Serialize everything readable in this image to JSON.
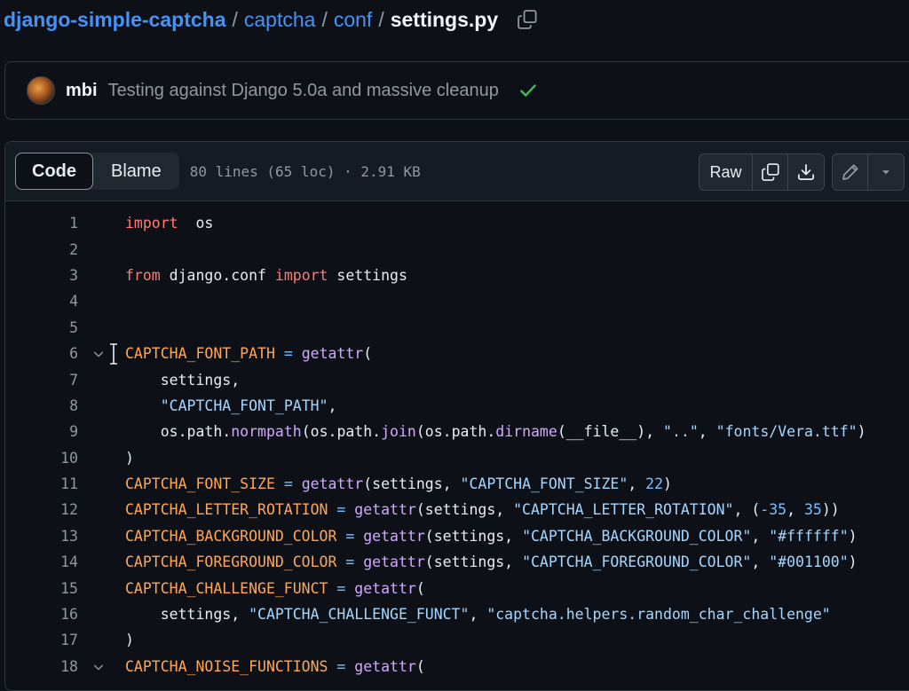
{
  "breadcrumb": {
    "repo": "django-simple-captcha",
    "sep": "/",
    "dir1": "captcha",
    "dir2": "conf",
    "file": "settings.py"
  },
  "commit": {
    "author": "mbi",
    "message": "Testing against Django 5.0a and massive cleanup",
    "status_color": "#3fb950"
  },
  "file_header": {
    "tabs": [
      "Code",
      "Blame"
    ],
    "active_tab": "Code",
    "info": "80 lines (65 loc) · 2.91 KB",
    "raw_label": "Raw"
  },
  "code_lines": [
    {
      "n": "1",
      "t": [
        [
          "kw",
          "import"
        ],
        [
          "",
          "  os"
        ]
      ]
    },
    {
      "n": "2",
      "t": []
    },
    {
      "n": "3",
      "t": [
        [
          "kw",
          "from"
        ],
        [
          "",
          " django.conf "
        ],
        [
          "kw",
          "import"
        ],
        [
          "",
          " settings"
        ]
      ]
    },
    {
      "n": "4",
      "t": []
    },
    {
      "n": "5",
      "t": []
    },
    {
      "n": "6",
      "fold": true,
      "t": [
        [
          "var",
          "CAPTCHA_FONT_PATH"
        ],
        [
          "",
          " "
        ],
        [
          "op",
          "="
        ],
        [
          "",
          " "
        ],
        [
          "fn",
          "getattr"
        ],
        [
          "",
          "("
        ]
      ]
    },
    {
      "n": "7",
      "t": [
        [
          "",
          "    settings,"
        ]
      ]
    },
    {
      "n": "8",
      "t": [
        [
          "",
          "    "
        ],
        [
          "str",
          "\"CAPTCHA_FONT_PATH\""
        ],
        [
          "",
          ","
        ]
      ]
    },
    {
      "n": "9",
      "t": [
        [
          "",
          "    os.path."
        ],
        [
          "fn",
          "normpath"
        ],
        [
          "",
          "(os.path."
        ],
        [
          "fn",
          "join"
        ],
        [
          "",
          "(os.path."
        ],
        [
          "fn",
          "dirname"
        ],
        [
          "",
          "(__file__), "
        ],
        [
          "str",
          "\"..\""
        ],
        [
          "",
          ", "
        ],
        [
          "str",
          "\"fonts/Vera.ttf\""
        ],
        [
          "",
          ")"
        ]
      ]
    },
    {
      "n": "10",
      "t": [
        [
          "",
          ")"
        ]
      ]
    },
    {
      "n": "11",
      "t": [
        [
          "var",
          "CAPTCHA_FONT_SIZE"
        ],
        [
          "",
          " "
        ],
        [
          "op",
          "="
        ],
        [
          "",
          " "
        ],
        [
          "fn",
          "getattr"
        ],
        [
          "",
          "(settings, "
        ],
        [
          "str",
          "\"CAPTCHA_FONT_SIZE\""
        ],
        [
          "",
          ", "
        ],
        [
          "num",
          "22"
        ],
        [
          "",
          ")"
        ]
      ]
    },
    {
      "n": "12",
      "t": [
        [
          "var",
          "CAPTCHA_LETTER_ROTATION"
        ],
        [
          "",
          " "
        ],
        [
          "op",
          "="
        ],
        [
          "",
          " "
        ],
        [
          "fn",
          "getattr"
        ],
        [
          "",
          "(settings, "
        ],
        [
          "str",
          "\"CAPTCHA_LETTER_ROTATION\""
        ],
        [
          "",
          ", ("
        ],
        [
          "num",
          "-35"
        ],
        [
          "",
          ", "
        ],
        [
          "num",
          "35"
        ],
        [
          "",
          "))"
        ]
      ]
    },
    {
      "n": "13",
      "t": [
        [
          "var",
          "CAPTCHA_BACKGROUND_COLOR"
        ],
        [
          "",
          " "
        ],
        [
          "op",
          "="
        ],
        [
          "",
          " "
        ],
        [
          "fn",
          "getattr"
        ],
        [
          "",
          "(settings, "
        ],
        [
          "str",
          "\"CAPTCHA_BACKGROUND_COLOR\""
        ],
        [
          "",
          ", "
        ],
        [
          "str",
          "\"#ffffff\""
        ],
        [
          "",
          ")"
        ]
      ]
    },
    {
      "n": "14",
      "t": [
        [
          "var",
          "CAPTCHA_FOREGROUND_COLOR"
        ],
        [
          "",
          " "
        ],
        [
          "op",
          "="
        ],
        [
          "",
          " "
        ],
        [
          "fn",
          "getattr"
        ],
        [
          "",
          "(settings, "
        ],
        [
          "str",
          "\"CAPTCHA_FOREGROUND_COLOR\""
        ],
        [
          "",
          ", "
        ],
        [
          "str",
          "\"#001100\""
        ],
        [
          "",
          ")"
        ]
      ]
    },
    {
      "n": "15",
      "t": [
        [
          "var",
          "CAPTCHA_CHALLENGE_FUNCT"
        ],
        [
          "",
          " "
        ],
        [
          "op",
          "="
        ],
        [
          "",
          " "
        ],
        [
          "fn",
          "getattr"
        ],
        [
          "",
          "("
        ]
      ]
    },
    {
      "n": "16",
      "t": [
        [
          "",
          "    settings, "
        ],
        [
          "str",
          "\"CAPTCHA_CHALLENGE_FUNCT\""
        ],
        [
          "",
          ", "
        ],
        [
          "str",
          "\"captcha.helpers.random_char_challenge\""
        ]
      ]
    },
    {
      "n": "17",
      "t": [
        [
          "",
          ")"
        ]
      ]
    },
    {
      "n": "18",
      "fold": true,
      "t": [
        [
          "var",
          "CAPTCHA_NOISE_FUNCTIONS"
        ],
        [
          "",
          " "
        ],
        [
          "op",
          "="
        ],
        [
          "",
          " "
        ],
        [
          "fn",
          "getattr"
        ],
        [
          "",
          "("
        ]
      ]
    }
  ]
}
